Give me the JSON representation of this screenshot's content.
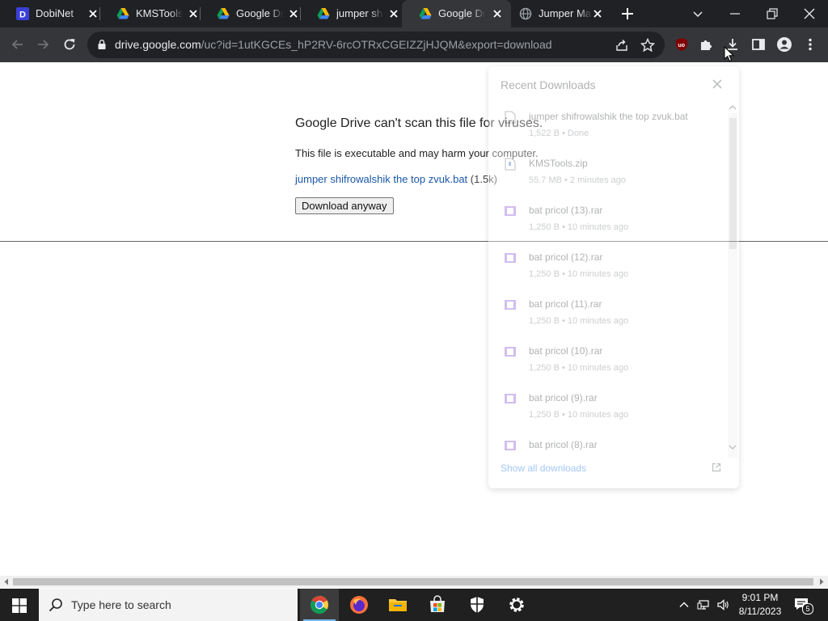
{
  "tabs": [
    {
      "title": "DobiNet",
      "icon": "dobinet-icon",
      "active": false
    },
    {
      "title": "KMSTools.zip",
      "icon": "google-drive-icon",
      "active": false
    },
    {
      "title": "Google Drive",
      "icon": "google-drive-icon",
      "active": false
    },
    {
      "title": "jumper shifrowalshik",
      "icon": "google-drive-icon",
      "active": false
    },
    {
      "title": "Google Drive",
      "icon": "google-drive-icon",
      "active": true
    },
    {
      "title": "Jumper Ma",
      "icon": "globe-icon",
      "active": false
    }
  ],
  "omnibox": {
    "host": "drive.google.com",
    "path": "/uc?id=1utKGCEs_hP2RV-6rcOTRxCGEIZZjHJQM&export=download"
  },
  "page": {
    "title": "Google Drive can't scan this file for viruses.",
    "warning": "This file is executable and may harm your computer.",
    "file_name": "jumper shifrowalshik the top zvuk.bat",
    "file_size": " (1.5k)",
    "download_button": "Download anyway"
  },
  "downloads": {
    "heading": "Recent Downloads",
    "items": [
      {
        "name": "jumper shifrowalshik the top zvuk.bat",
        "meta": "1,522 B • Done"
      },
      {
        "name": "KMSTools.zip",
        "meta": "55.7 MB • 2 minutes ago"
      },
      {
        "name": "bat pricol (13).rar",
        "meta": "1,250 B • 10 minutes ago"
      },
      {
        "name": "bat pricol (12).rar",
        "meta": "1,250 B • 10 minutes ago"
      },
      {
        "name": "bat pricol (11).rar",
        "meta": "1,250 B • 10 minutes ago"
      },
      {
        "name": "bat pricol (10).rar",
        "meta": "1,250 B • 10 minutes ago"
      },
      {
        "name": "bat pricol (9).rar",
        "meta": "1,250 B • 10 minutes ago"
      },
      {
        "name": "bat pricol (8).rar",
        "meta": ""
      }
    ],
    "show_all": "Show all downloads"
  },
  "taskbar": {
    "search_placeholder": "Type here to search",
    "time": "9:01 PM",
    "date": "8/11/2023",
    "notification_count": "5"
  },
  "colors": {
    "tabstrip": "#202124",
    "toolbar": "#35363a",
    "link": "#1a57a8",
    "accent": "#1a73e8"
  }
}
